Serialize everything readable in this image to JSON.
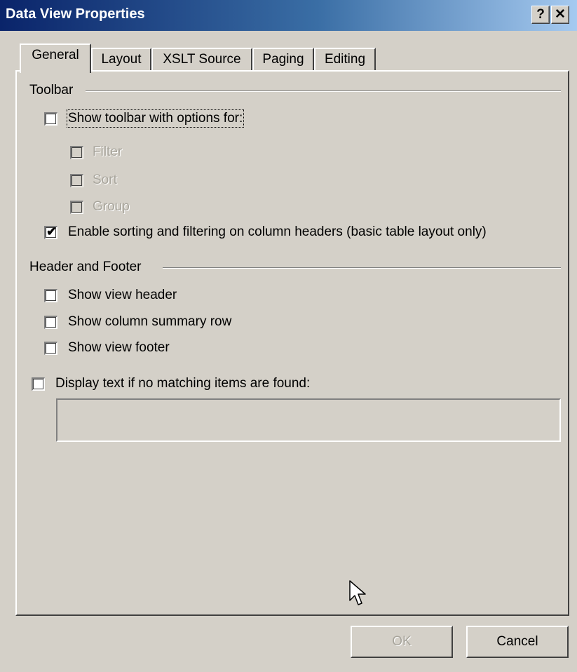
{
  "window": {
    "title": "Data View Properties",
    "help_label": "?",
    "close_label": "✕"
  },
  "tabs": [
    {
      "label": "General",
      "active": true
    },
    {
      "label": "Layout",
      "active": false
    },
    {
      "label": "XSLT Source",
      "active": false
    },
    {
      "label": "Paging",
      "active": false
    },
    {
      "label": "Editing",
      "active": false
    }
  ],
  "toolbar_group": {
    "label": "Toolbar",
    "show_toolbar": {
      "label": "Show toolbar with options for:",
      "checked": false
    },
    "filter": {
      "label": "Filter",
      "checked": false,
      "enabled": false
    },
    "sort": {
      "label": "Sort",
      "checked": false,
      "enabled": false
    },
    "group": {
      "label": "Group",
      "checked": false,
      "enabled": false
    },
    "enable_sorting": {
      "label": "Enable sorting and filtering on column headers (basic table layout only)",
      "checked": true
    }
  },
  "header_footer_group": {
    "label": "Header and Footer",
    "show_view_header": {
      "label": "Show view header",
      "checked": false
    },
    "show_column_summary": {
      "label": "Show column summary row",
      "checked": false
    },
    "show_view_footer": {
      "label": "Show view footer",
      "checked": false
    }
  },
  "no_items": {
    "label": "Display text if no matching items are found:",
    "checked": false,
    "text_value": ""
  },
  "buttons": {
    "ok_label": "OK",
    "cancel_label": "Cancel"
  },
  "colors": {
    "dialog_face": "#d4d0c8",
    "title_gradient_start": "#0a246a",
    "title_gradient_end": "#a6caf0",
    "disabled_text": "#a8a59c"
  }
}
